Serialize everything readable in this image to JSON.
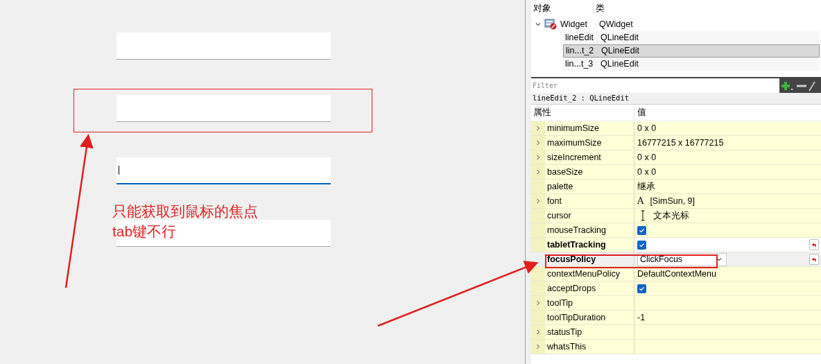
{
  "canvas": {
    "line_edits": [
      {
        "focused": false
      },
      {
        "focused": false
      },
      {
        "focused": true
      },
      {
        "focused": false
      }
    ],
    "note": [
      "只能获取到鼠标的焦点",
      "tab键不行"
    ]
  },
  "object_inspector": {
    "columns": [
      "对象",
      "类"
    ],
    "tree": [
      {
        "name": "Widget",
        "class": "QWidget",
        "expanded": true,
        "selected": false,
        "children": [
          {
            "name": "lineEdit",
            "class": "QLineEdit",
            "selected": false
          },
          {
            "name": "lin...t_2",
            "class": "QLineEdit",
            "selected": true
          },
          {
            "name": "lin...t_3",
            "class": "QLineEdit",
            "selected": false
          }
        ]
      }
    ]
  },
  "property_editor": {
    "filter": {
      "placeholder": "Filter"
    },
    "selection_label": "lineEdit_2 : QLineEdit",
    "columns": [
      "属性",
      "值"
    ],
    "properties": [
      {
        "name": "minimumSize",
        "selected": false,
        "value": "0 x 0",
        "kind": "text",
        "expandable": true,
        "modified": false
      },
      {
        "name": "maximumSize",
        "selected": false,
        "value": "16777215 x 16777215",
        "kind": "text",
        "expandable": true,
        "modified": false
      },
      {
        "name": "sizeIncrement",
        "selected": false,
        "value": "0 x 0",
        "kind": "text",
        "expandable": true,
        "modified": false
      },
      {
        "name": "baseSize",
        "selected": false,
        "value": "0 x 0",
        "kind": "text",
        "expandable": true,
        "modified": false
      },
      {
        "name": "palette",
        "selected": false,
        "value": "继承",
        "kind": "text",
        "expandable": false,
        "modified": false
      },
      {
        "name": "font",
        "selected": false,
        "glyph": "A",
        "value": "[SimSun, 9]",
        "kind": "font",
        "expandable": true,
        "modified": false
      },
      {
        "name": "cursor",
        "selected": false,
        "value": "文本光标",
        "kind": "cursor",
        "expandable": false,
        "modified": false
      },
      {
        "name": "mouseTracking",
        "selected": false,
        "checked": true,
        "kind": "checkbox",
        "expandable": false,
        "modified": false
      },
      {
        "name": "tabletTracking",
        "selected": false,
        "checked": true,
        "kind": "checkbox",
        "expandable": false,
        "modified": true
      },
      {
        "name": "focusPolicy",
        "selected": true,
        "value": "ClickFocus",
        "kind": "combo",
        "expandable": false,
        "modified": true
      },
      {
        "name": "contextMenuPolicy",
        "selected": false,
        "value": "DefaultContextMenu",
        "kind": "text",
        "expandable": false,
        "modified": false
      },
      {
        "name": "acceptDrops",
        "selected": false,
        "checked": true,
        "kind": "checkbox",
        "expandable": false,
        "modified": false
      },
      {
        "name": "toolTip",
        "selected": false,
        "kind": "text",
        "expandable": true,
        "modified": false
      },
      {
        "name": "toolTipDuration",
        "selected": false,
        "value": "-1",
        "kind": "text",
        "expandable": false,
        "modified": false
      },
      {
        "name": "statusTip",
        "selected": false,
        "kind": "text",
        "expandable": true,
        "modified": false
      },
      {
        "name": "whatsThis",
        "selected": false,
        "kind": "text",
        "expandable": true,
        "modified": false
      }
    ]
  }
}
